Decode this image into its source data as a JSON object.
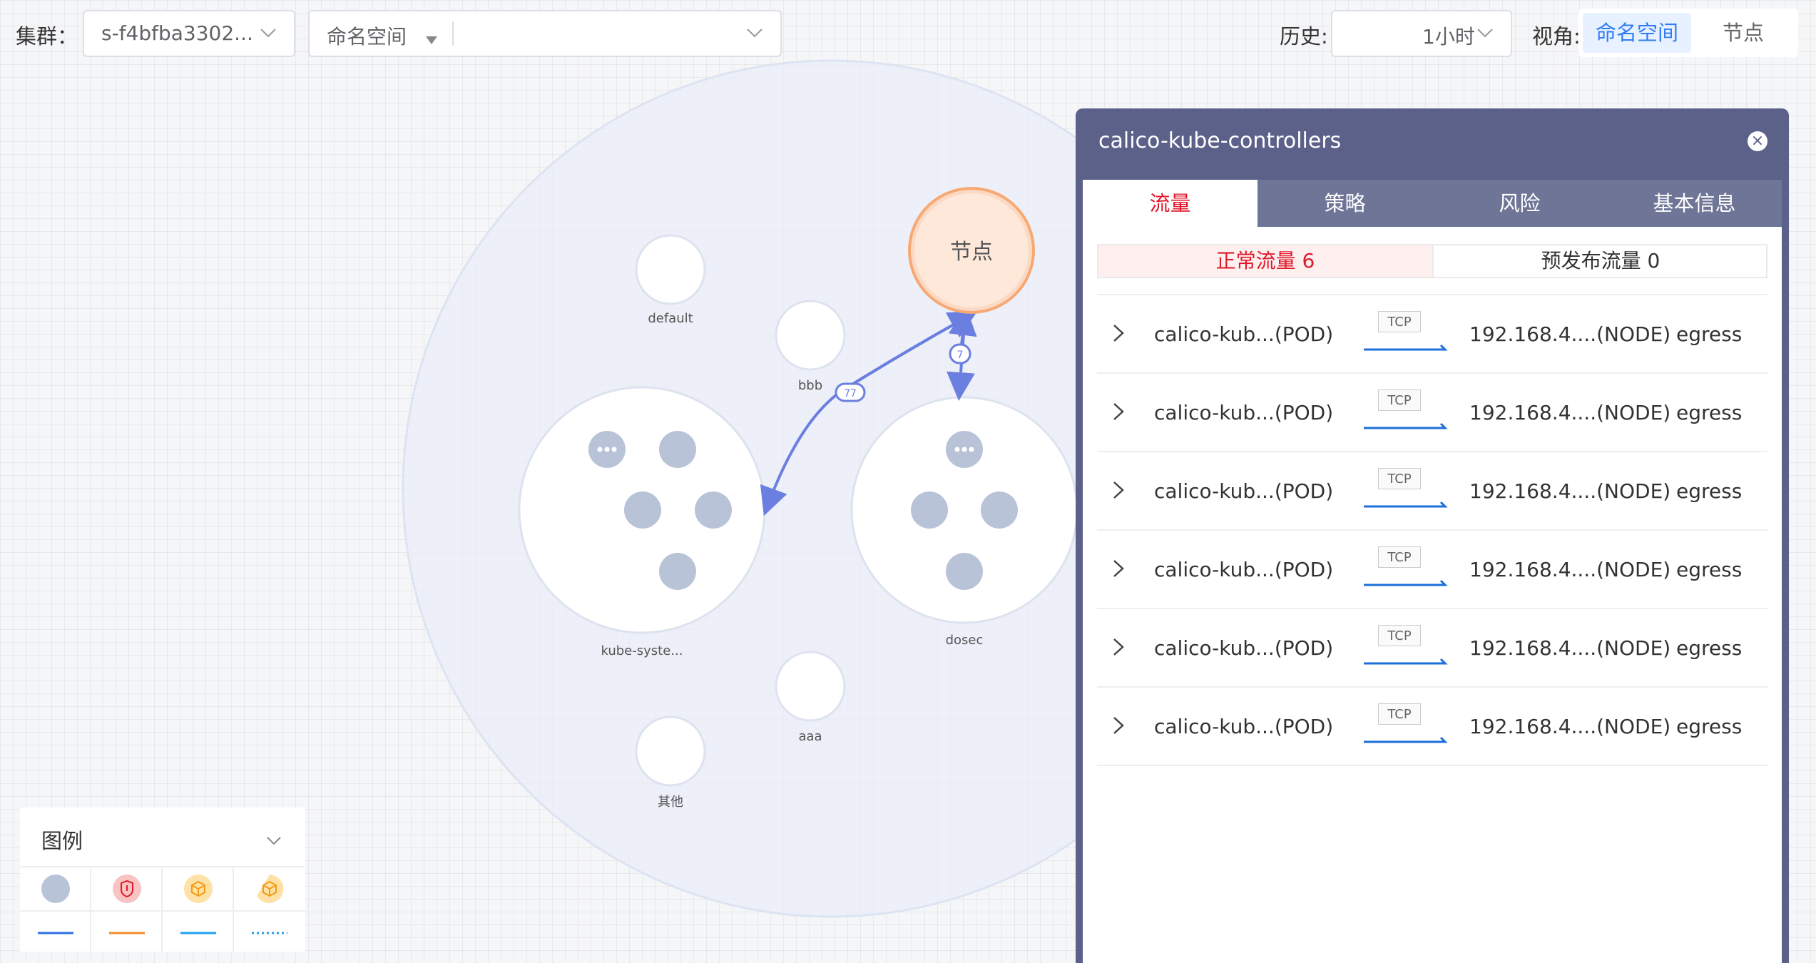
{
  "toolbar": {
    "cluster_label": "集群：",
    "cluster_value": "s-f4bfba3302...",
    "namespace_placeholder": "命名空间",
    "history_label": "历史:",
    "history_value": "1小时",
    "view_label": "视角:",
    "view_options": [
      "命名空间",
      "节点"
    ],
    "view_selected": "命名空间"
  },
  "graph": {
    "nodes": {
      "node": "节点",
      "default": "default",
      "bbb": "bbb",
      "kube_system": "kube-syste...",
      "dosec": "dosec",
      "aaa": "aaa",
      "other": "其他"
    },
    "edges": {
      "node_to_kube": "77",
      "node_to_dosec": "7"
    },
    "colors": {
      "edge": "#6b7fe0",
      "node_fill": "#fcd9c3",
      "node_stroke": "#f7a873",
      "pod": "#b9c3d8"
    }
  },
  "panel": {
    "title": "calico-kube-controllers",
    "close_icon": "close-icon",
    "tabs": [
      "流量",
      "策略",
      "风险",
      "基本信息"
    ],
    "active_tab": "流量",
    "subtabs": [
      "正常流量 6",
      "预发布流量 0"
    ],
    "flows": [
      {
        "src": "calico-kub...(POD)",
        "protocol": "TCP",
        "dst": "192.168.4....(NODE)",
        "direction": "egress"
      },
      {
        "src": "calico-kub...(POD)",
        "protocol": "TCP",
        "dst": "192.168.4....(NODE)",
        "direction": "egress"
      },
      {
        "src": "calico-kub...(POD)",
        "protocol": "TCP",
        "dst": "192.168.4....(NODE)",
        "direction": "egress"
      },
      {
        "src": "calico-kub...(POD)",
        "protocol": "TCP",
        "dst": "192.168.4....(NODE)",
        "direction": "egress"
      },
      {
        "src": "calico-kub...(POD)",
        "protocol": "TCP",
        "dst": "192.168.4....(NODE)",
        "direction": "egress"
      },
      {
        "src": "calico-kub...(POD)",
        "protocol": "TCP",
        "dst": "192.168.4....(NODE)",
        "direction": "egress"
      }
    ],
    "accent": "#e0192b",
    "header_color": "#5b6189"
  },
  "legend": {
    "title": "图例",
    "icons": [
      "pod-icon",
      "risk-shield-icon",
      "workload-cube-icon",
      "workload-cube-partial-icon"
    ],
    "lines": [
      "blue-solid-line",
      "orange-solid-line",
      "lightblue-solid-line",
      "lightblue-dotted-line"
    ]
  }
}
